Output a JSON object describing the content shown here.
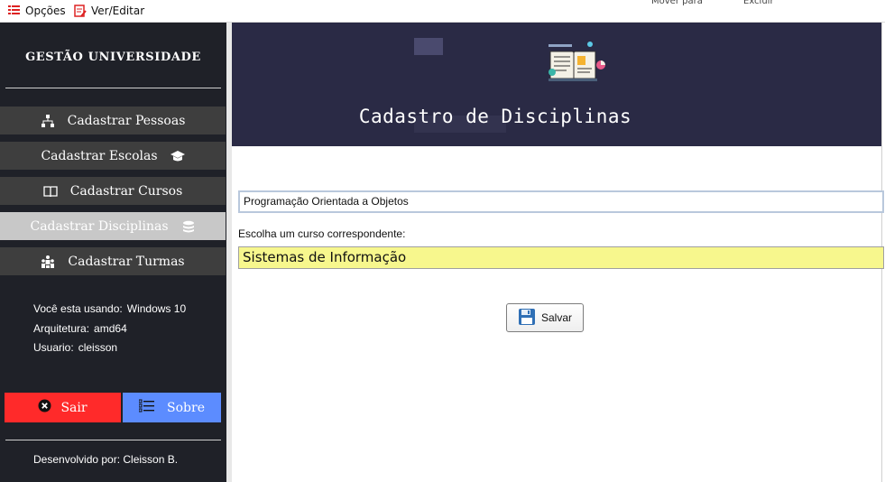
{
  "menubar": {
    "opcoes_label": "Opções",
    "editar_label": "Ver/Editar",
    "bg_partial_1": "Mover para",
    "bg_partial_2": "Excluir"
  },
  "sidebar": {
    "title": "GESTÃO UNIVERSIDADE",
    "items": [
      {
        "label": "Cadastrar Pessoas",
        "icon": "sitemap-icon"
      },
      {
        "label": "Cadastrar Escolas",
        "icon": "graduation-cap-icon"
      },
      {
        "label": "Cadastrar Cursos",
        "icon": "book-open-icon"
      },
      {
        "label": "Cadastrar Disciplinas",
        "icon": "stack-icon",
        "active": true
      },
      {
        "label": "Cadastrar Turmas",
        "icon": "group-icon"
      }
    ],
    "info": {
      "os_label": "Você esta usando:",
      "os_value": "Windows 10",
      "arch_label": "Arquitetura:",
      "arch_value": "amd64",
      "user_label": "Usuario:",
      "user_value": "cleisson"
    },
    "sair_label": "Sair",
    "sobre_label": "Sobre",
    "dev_text": "Desenvolvido por: Cleisson B."
  },
  "header": {
    "title": "Cadastro de Disciplinas",
    "icon": "book-chart-icon"
  },
  "form": {
    "disciplina_value": "Programação Orientada a Objetos",
    "curso_label": "Escolha um curso correspondente:",
    "curso_selected": "Sistemas de Informação",
    "salvar_label": "Salvar"
  },
  "colors": {
    "sidebar_bg": "#1f2128",
    "sidebar_btn": "#3e3e3e",
    "sidebar_active": "#c8c8c8",
    "header_bg": "#2a2a45",
    "sair": "#ff2a2a",
    "sobre": "#5c8cff",
    "select_bg": "#f7f78d"
  }
}
